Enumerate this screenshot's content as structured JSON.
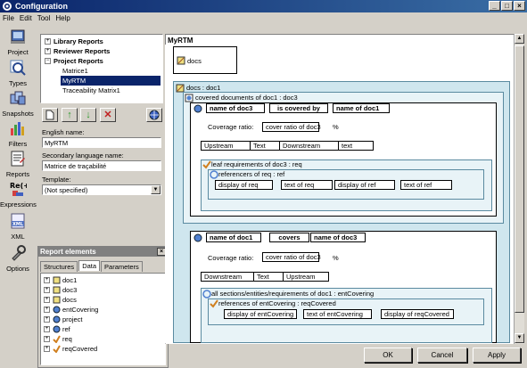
{
  "window": {
    "title": "Configuration"
  },
  "menu": [
    "File",
    "Edit",
    "Tool",
    "Help"
  ],
  "sidebar": [
    {
      "label": "Project",
      "icon": "project-icon"
    },
    {
      "label": "Types",
      "icon": "types-icon"
    },
    {
      "label": "Snapshots",
      "icon": "snapshots-icon"
    },
    {
      "label": "Filters",
      "icon": "filters-icon"
    },
    {
      "label": "Reports",
      "icon": "reports-icon"
    },
    {
      "label": "Expressions",
      "icon": "expressions-icon"
    },
    {
      "label": "XML",
      "icon": "xml-icon"
    },
    {
      "label": "Options",
      "icon": "options-icon"
    }
  ],
  "tree": {
    "items": [
      "Library Reports",
      "Reviewer Reports",
      "Project Reports",
      "Matrice1",
      "MyRTM",
      "Traceability Matrix1"
    ],
    "selected": "MyRTM"
  },
  "form": {
    "english_name_label": "English name:",
    "english_name_value": "MyRTM",
    "secondary_label": "Secondary language name:",
    "secondary_value": "Matrice de traçabilité",
    "template_label": "Template:",
    "template_value": "(Not specified)"
  },
  "report_elements": {
    "title": "Report elements",
    "tabs": [
      "Structures",
      "Data",
      "Parameters"
    ],
    "active_tab": "Data",
    "items": [
      "doc1",
      "doc3",
      "docs",
      "entCovering",
      "project",
      "ref",
      "req",
      "reqCovered"
    ]
  },
  "canvas": {
    "title": "MyRTM",
    "docs_label": "docs",
    "docs_doc1": "docs : doc1",
    "covered_docs": "covered documents of doc1 : doc3",
    "table1": {
      "left": "name of doc3",
      "mid": "is covered by",
      "right": "name of doc1"
    },
    "coverage_label": "Coverage ratio:",
    "coverage1": "cover ratio of doc3",
    "percent": "%",
    "row1": [
      "Upstream",
      "Text",
      "Downstream",
      "text"
    ],
    "leaf_req": "leaf requirements of doc3 : req",
    "referencers": "referencers of req : ref",
    "row2": [
      "display of req",
      "text of req",
      "display of ref",
      "text of ref"
    ],
    "table2": {
      "left": "name of doc1",
      "mid": "covers",
      "right": "name of doc3"
    },
    "coverage2": "cover ratio of doc3",
    "row3": [
      "Downstream",
      "Text",
      "Upstream"
    ],
    "all_sections": "all sections/entities/requirements of doc1 : entCovering",
    "references": "references of entCovering : reqCovered",
    "row4": [
      "display of entCovering",
      "text of entCovering",
      "display of reqCovered"
    ]
  },
  "buttons": {
    "ok": "OK",
    "cancel": "Cancel",
    "apply": "Apply"
  }
}
